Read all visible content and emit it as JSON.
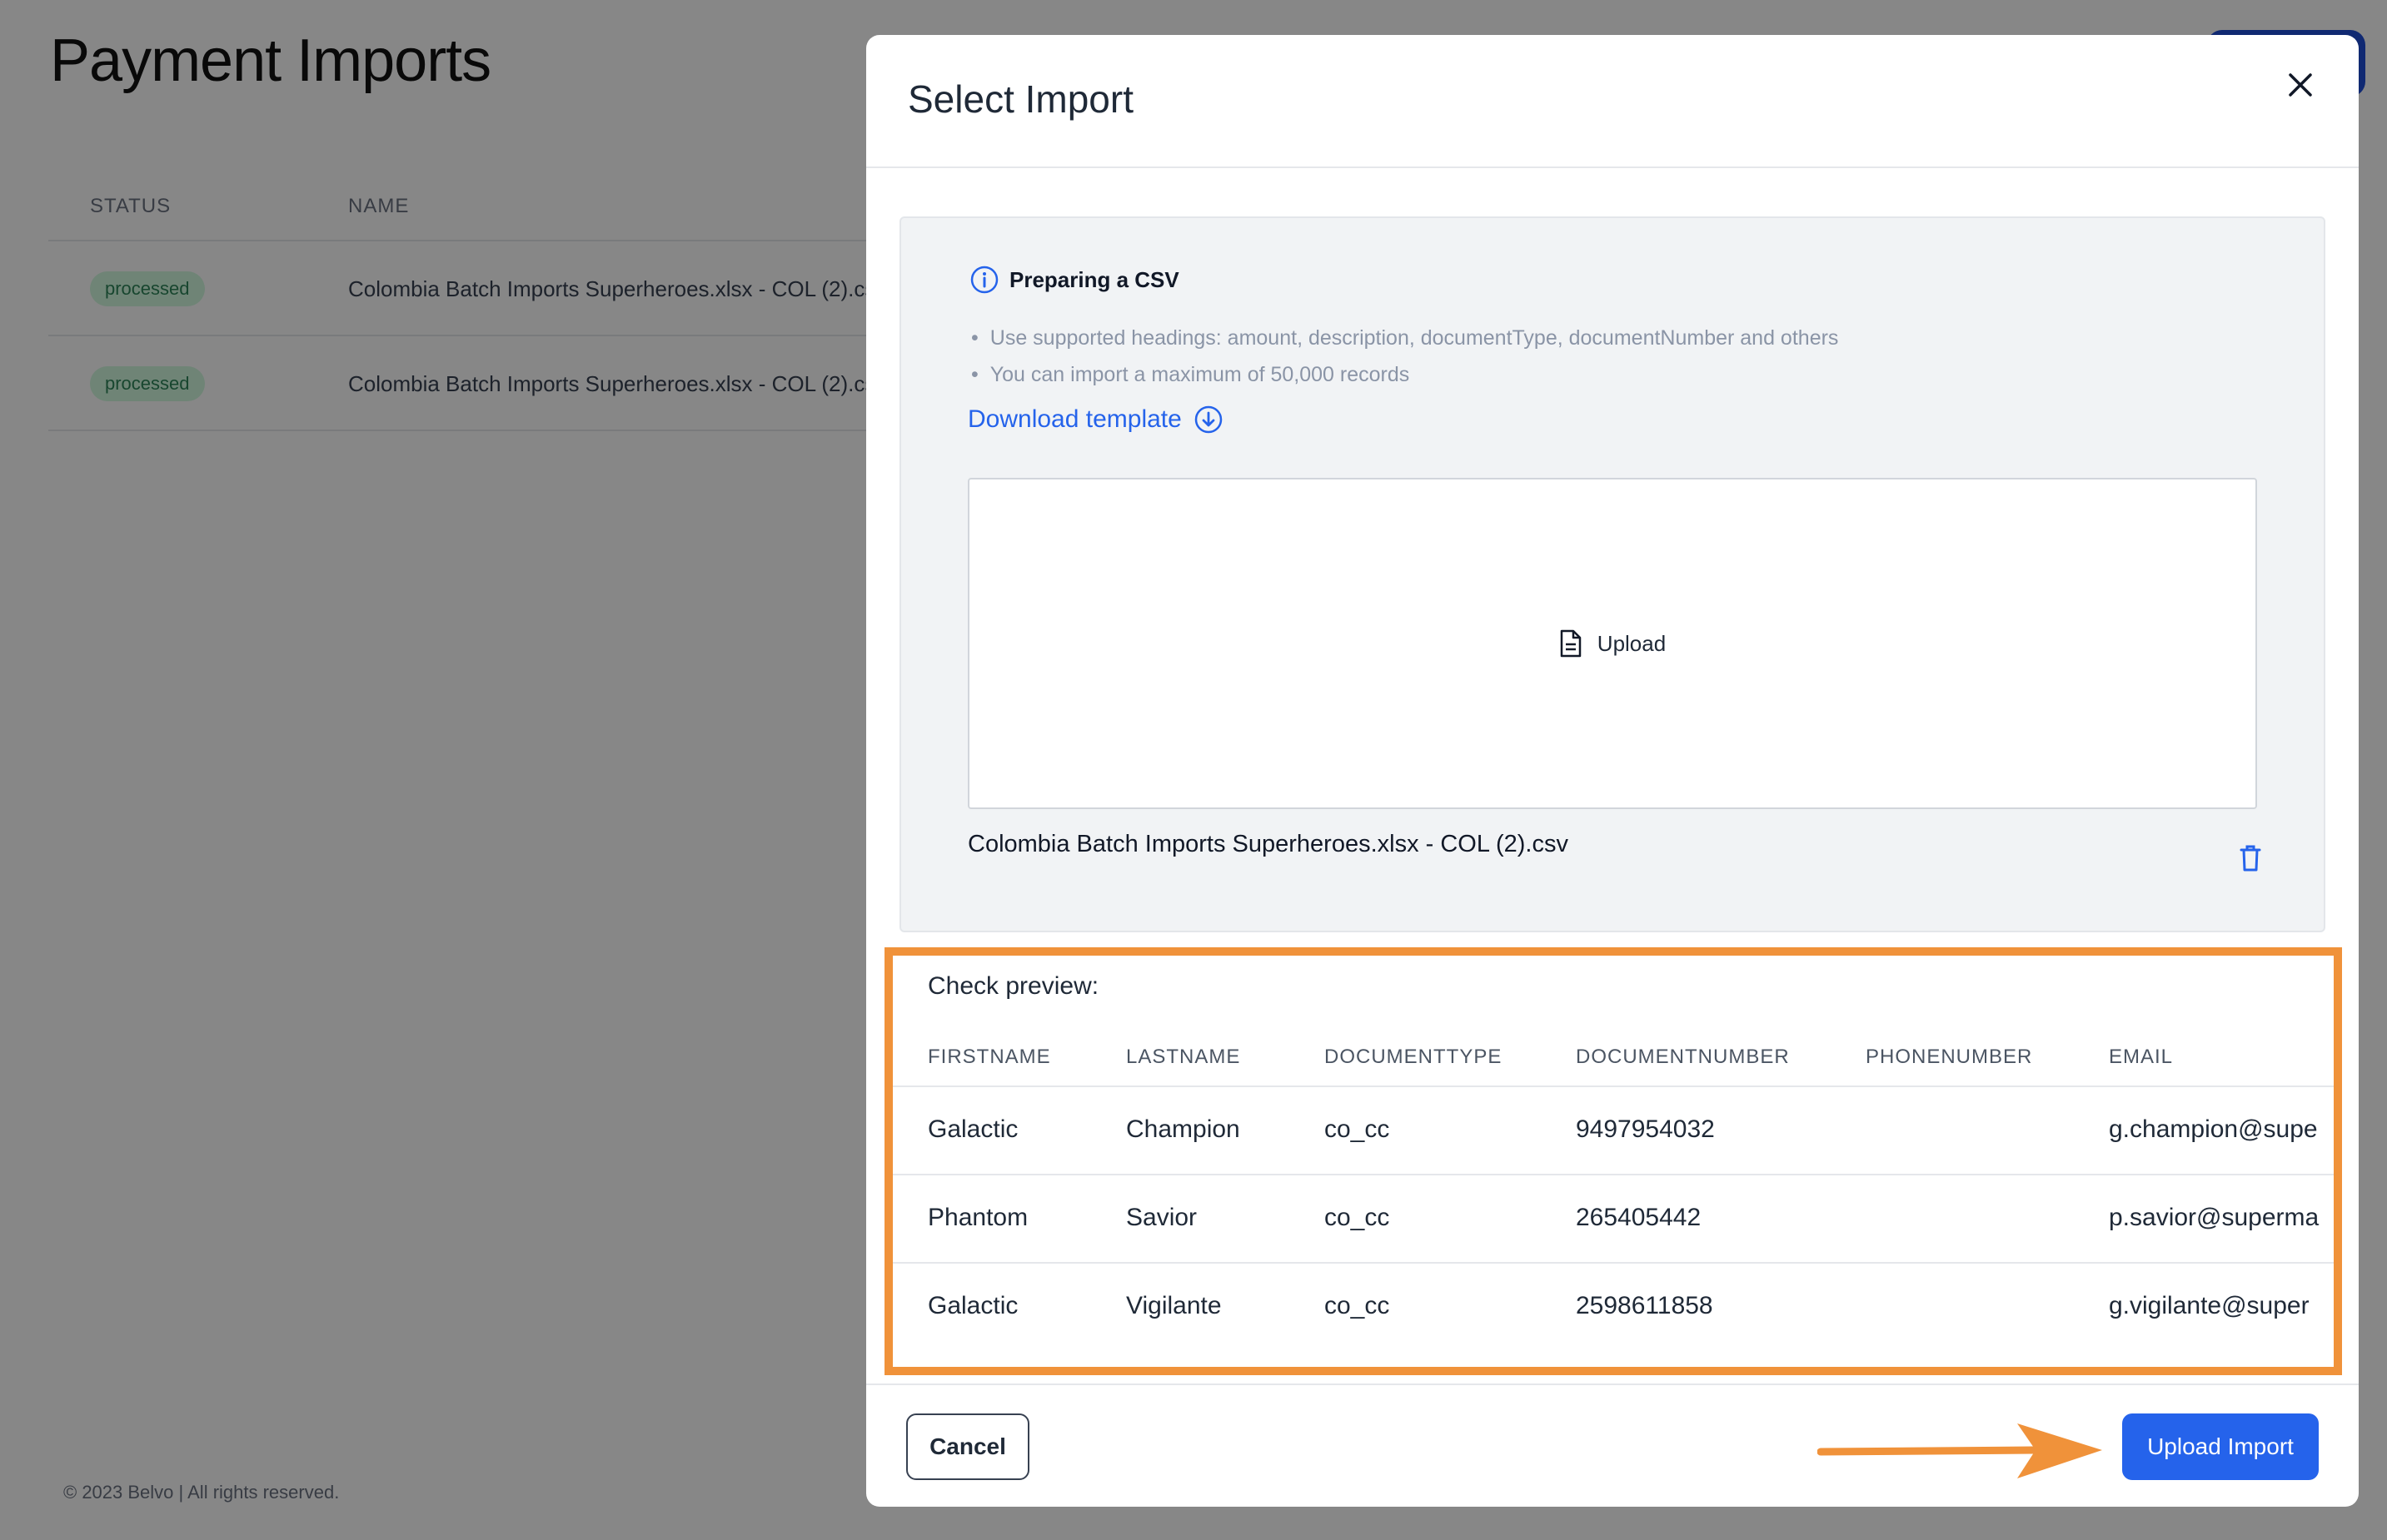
{
  "background": {
    "page_title": "Payment Imports",
    "table": {
      "columns": [
        "STATUS",
        "NAME"
      ],
      "rows": [
        {
          "status": "processed",
          "name": "Colombia Batch Imports Superheroes.xlsx - COL (2).csv"
        },
        {
          "status": "processed",
          "name": "Colombia Batch Imports Superheroes.xlsx - COL (2).csv"
        }
      ]
    },
    "footer": "© 2023 Belvo | All rights reserved.",
    "colors": {
      "status_badge_bg": "#d1fadf",
      "status_badge_text": "#2f855a",
      "corner_button": "#1f4fd8"
    }
  },
  "modal": {
    "title": "Select Import",
    "close_icon": "close-icon",
    "info": {
      "icon": "info-circle-icon",
      "title": "Preparing a CSV",
      "bullets": [
        "Use supported headings: amount, description, documentType, documentNumber and others",
        "You can import a maximum of 50,000 records"
      ],
      "download_label": "Download template",
      "download_icon": "download-circle-icon"
    },
    "dropzone": {
      "label": "Upload",
      "icon": "file-icon"
    },
    "file": {
      "name": "Colombia Batch Imports Superheroes.xlsx - COL (2).csv",
      "delete_icon": "trash-icon"
    },
    "preview": {
      "label": "Check preview:",
      "columns": [
        "FIRSTNAME",
        "LASTNAME",
        "DOCUMENTTYPE",
        "DOCUMENTNUMBER",
        "PHONENUMBER",
        "EMAIL"
      ],
      "rows": [
        [
          "Galactic",
          "Champion",
          "co_cc",
          "9497954032",
          "",
          "g.champion@supe"
        ],
        [
          "Phantom",
          "Savior",
          "co_cc",
          "265405442",
          "",
          "p.savior@superma"
        ],
        [
          "Galactic",
          "Vigilante",
          "co_cc",
          "2598611858",
          "",
          "g.vigilante@super"
        ]
      ]
    },
    "buttons": {
      "cancel": "Cancel",
      "upload": "Upload Import"
    },
    "colors": {
      "primary": "#2563eb",
      "highlight": "#f0923a",
      "panel_bg": "#f1f3f5"
    }
  }
}
